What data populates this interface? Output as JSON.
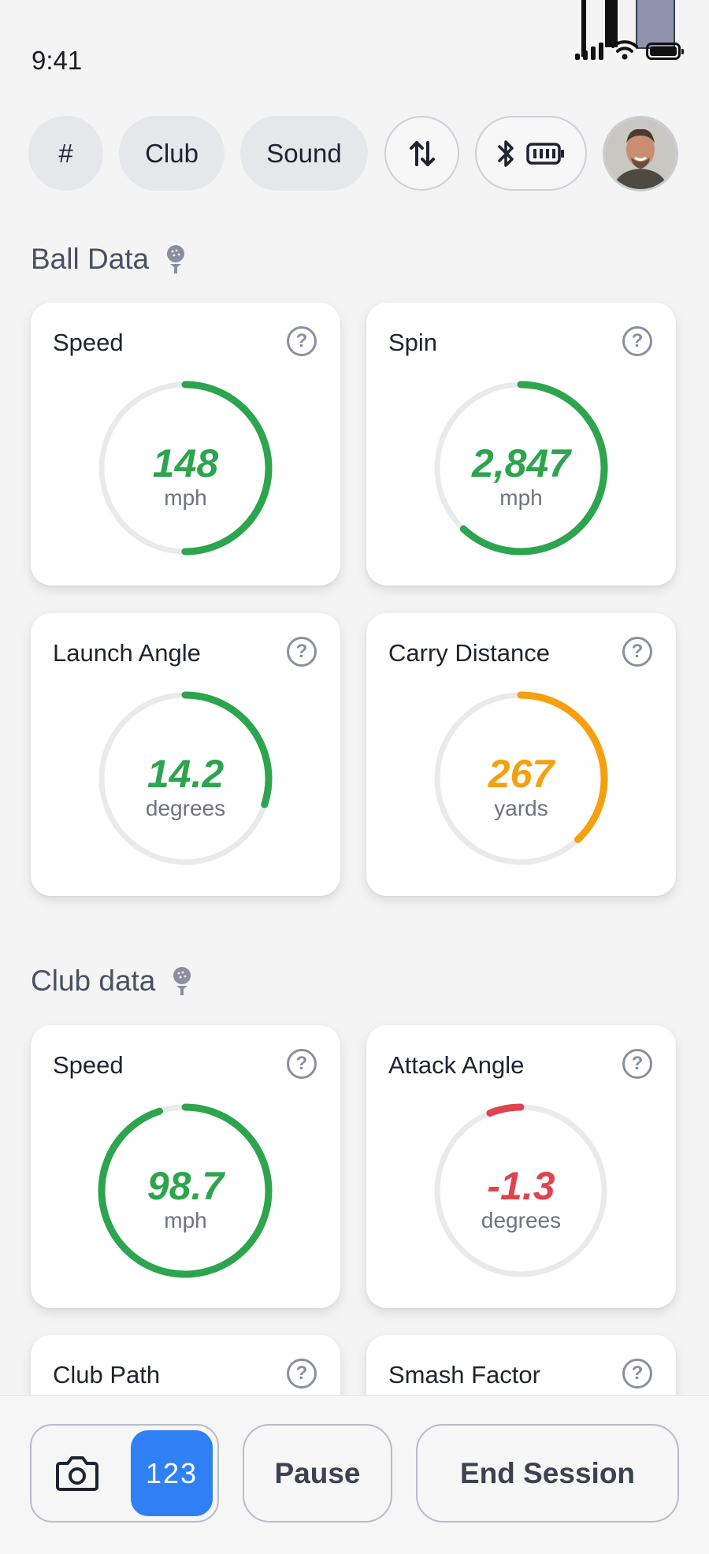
{
  "status_bar": {
    "time": "9:41"
  },
  "toolbar": {
    "chips": [
      {
        "label": "#"
      },
      {
        "label": "Club"
      },
      {
        "label": "Sound"
      }
    ],
    "icons": [
      "swap-vertical-icon",
      "bluetooth-icon",
      "device-battery-icon"
    ]
  },
  "sections": {
    "ball": {
      "title": "Ball Data",
      "icon": "golf-ball-on-tee-icon"
    },
    "club": {
      "title": "Club data",
      "icon": "golf-ball-on-tee-icon"
    }
  },
  "ball_cards": [
    {
      "label": "Speed",
      "value": "148",
      "unit": "mph",
      "progress": 0.5,
      "color": "#2da44e"
    },
    {
      "label": "Spin",
      "value": "2,847",
      "unit": "mph",
      "progress": 0.62,
      "color": "#2da44e"
    },
    {
      "label": "Launch Angle",
      "value": "14.2",
      "unit": "degrees",
      "progress": 0.3,
      "color": "#2da44e"
    },
    {
      "label": "Carry Distance",
      "value": "267",
      "unit": "yards",
      "progress": 0.38,
      "color": "#f5a00f"
    }
  ],
  "club_cards": [
    {
      "label": "Speed",
      "value": "98.7",
      "unit": "mph",
      "progress": 0.95,
      "color": "#2da44e"
    },
    {
      "label": "Attack Angle",
      "value": "-1.3",
      "unit": "degrees",
      "progress": 0.06,
      "color": "#e0434d",
      "direction": "ccw"
    },
    {
      "label": "Club Path"
    },
    {
      "label": "Smash Factor"
    }
  ],
  "bottom_bar": {
    "numeric_toggle": "123",
    "pause_label": "Pause",
    "end_label": "End Session"
  }
}
